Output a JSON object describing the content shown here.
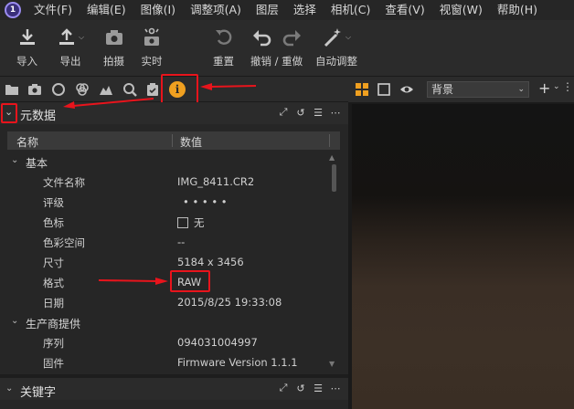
{
  "menu": [
    "文件(F)",
    "编辑(E)",
    "图像(I)",
    "调整项(A)",
    "图层",
    "选择",
    "相机(C)",
    "查看(V)",
    "视窗(W)",
    "帮助(H)"
  ],
  "toolbar": {
    "import": "导入",
    "export": "导出",
    "capture": "拍摄",
    "live": "实时",
    "reset": "重置",
    "undo_redo": "撤销 / 重做",
    "auto_adjust": "自动调整"
  },
  "metadata": {
    "title": "元数据",
    "col_name": "名称",
    "col_value": "数值",
    "group_basic": "基本",
    "rows": [
      {
        "k": "文件名称",
        "v": "IMG_8411.CR2"
      },
      {
        "k": "评级",
        "v": "•     •     •     •     •"
      },
      {
        "k": "色标",
        "v": "无"
      },
      {
        "k": "色彩空间",
        "v": "--"
      },
      {
        "k": "尺寸",
        "v": "5184 x 3456"
      },
      {
        "k": "格式",
        "v": "RAW"
      },
      {
        "k": "日期",
        "v": "2015/8/25 19:33:08"
      }
    ],
    "group_manufacturer": "生产商提供",
    "rows2": [
      {
        "k": "序列",
        "v": "094031004997"
      },
      {
        "k": "固件",
        "v": "Firmware Version 1.1.1"
      }
    ]
  },
  "keywords": {
    "title": "关键字"
  },
  "viewer": {
    "background_select": "背景"
  },
  "colors": {
    "highlight": "#e8141c",
    "info_tab": "#f0a020"
  }
}
